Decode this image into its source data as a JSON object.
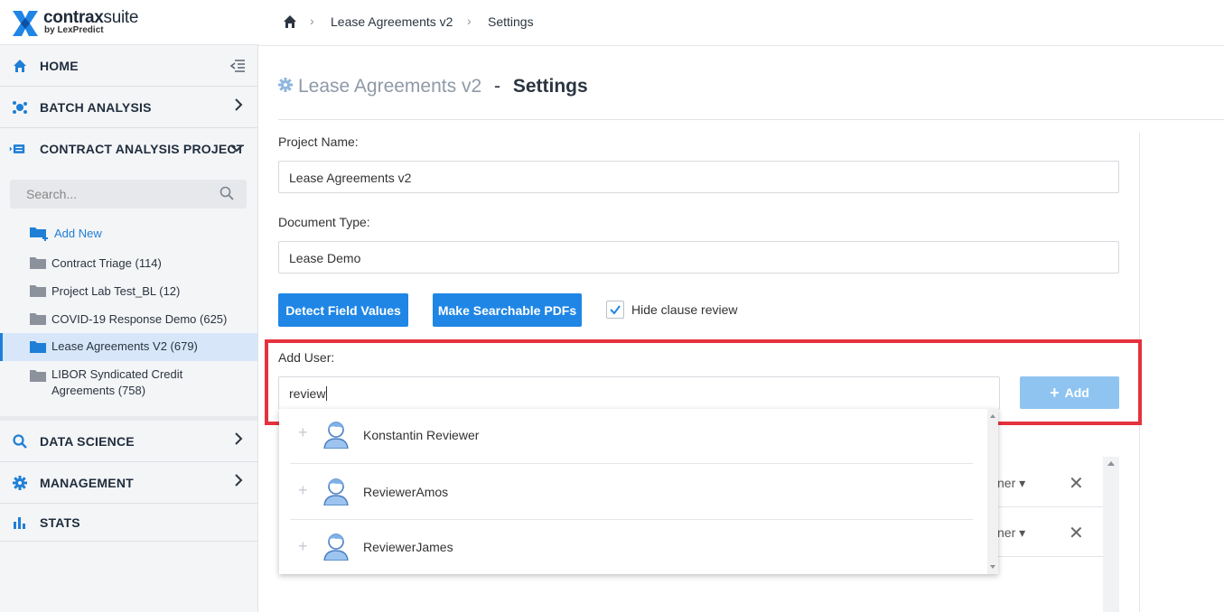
{
  "brand": {
    "name_bold": "contrax",
    "name_thin": "suite",
    "byline": "by LexPredict"
  },
  "sidebar": {
    "nav": [
      {
        "label": "HOME",
        "icon": "home-icon"
      },
      {
        "label": "BATCH ANALYSIS",
        "icon": "batch-icon"
      },
      {
        "label": "CONTRACT ANALYSIS PROJECT",
        "icon": "project-icon"
      },
      {
        "label": "DATA SCIENCE",
        "icon": "search-icon"
      },
      {
        "label": "MANAGEMENT",
        "icon": "gear-icon"
      },
      {
        "label": "STATS",
        "icon": "stats-icon"
      }
    ],
    "search_placeholder": "Search...",
    "add_new": "Add New",
    "projects": [
      {
        "label": "Contract Triage (114)"
      },
      {
        "label": "Project Lab Test_BL (12)"
      },
      {
        "label": "COVID-19 Response Demo (625)"
      },
      {
        "label": "Lease Agreements V2 (679)",
        "active": true
      },
      {
        "label": "LIBOR Syndicated Credit Agreements (758)"
      }
    ]
  },
  "breadcrumb": {
    "project": "Lease Agreements v2",
    "page": "Settings"
  },
  "header": {
    "project": "Lease Agreements v2",
    "sep": "-",
    "page": "Settings"
  },
  "form": {
    "project_name_label": "Project Name:",
    "project_name_value": "Lease Agreements v2",
    "doc_type_label": "Document Type:",
    "doc_type_value": "Lease Demo",
    "detect_btn": "Detect Field Values",
    "pdf_btn": "Make Searchable PDFs",
    "hide_clause_label": "Hide clause review",
    "hide_clause_checked": true,
    "add_user_label": "Add User:",
    "add_user_value": "review",
    "add_btn": "Add"
  },
  "suggestions": [
    {
      "name": "Konstantin Reviewer"
    },
    {
      "name": "ReviewerAmos"
    },
    {
      "name": "ReviewerJames"
    }
  ],
  "users_table": {
    "role_partial": "ner"
  },
  "colors": {
    "accent": "#1f86e6",
    "highlight": "#e5323d",
    "active_bg": "#d7e7f9"
  }
}
